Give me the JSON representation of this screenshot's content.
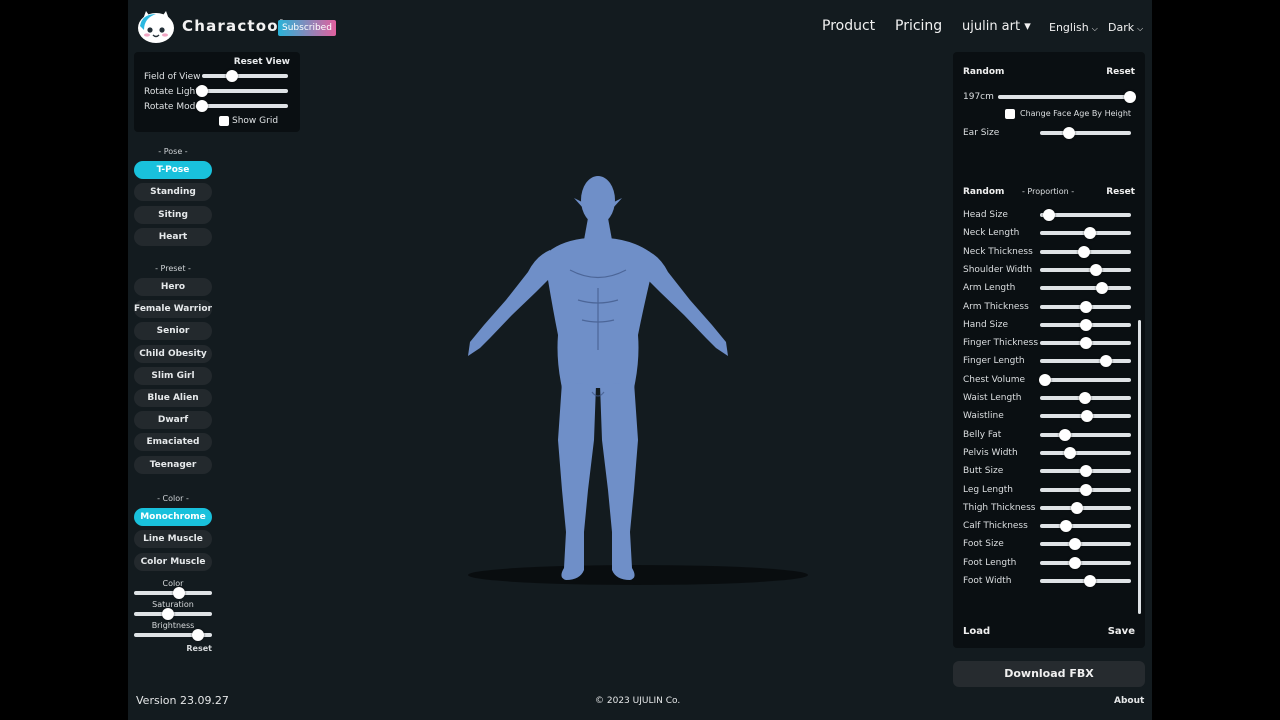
{
  "header": {
    "brand": "Charactool",
    "badge": "Subscribed",
    "nav": {
      "product": "Product",
      "pricing": "Pricing",
      "user": "ujulin art ▾",
      "language": "English",
      "theme": "Dark"
    }
  },
  "view": {
    "reset_label": "Reset View",
    "sliders": [
      {
        "label": "Field of View",
        "value": 0.35
      },
      {
        "label": "Rotate Light",
        "value": 0.0
      },
      {
        "label": "Rotate Model",
        "value": 0.0
      }
    ],
    "show_grid": {
      "label": "Show Grid",
      "checked": false
    }
  },
  "pose": {
    "title": "- Pose -",
    "items": [
      "T-Pose",
      "Standing",
      "Siting",
      "Heart"
    ],
    "active": 0
  },
  "preset": {
    "title": "- Preset -",
    "items": [
      "Hero",
      "Female Warrior",
      "Senior",
      "Child Obesity",
      "Slim Girl",
      "Blue Alien",
      "Dwarf",
      "Emaciated",
      "Teenager"
    ]
  },
  "color": {
    "title": "- Color -",
    "items": [
      "Monochrome",
      "Line Muscle",
      "Color Muscle"
    ],
    "active": 0,
    "sliders": [
      {
        "label": "Color",
        "value": 0.58
      },
      {
        "label": "Saturation",
        "value": 0.44
      },
      {
        "label": "Brightness",
        "value": 0.82
      }
    ],
    "reset_label": "Reset"
  },
  "body": {
    "random_label": "Random",
    "reset_label": "Reset",
    "height": {
      "label": "197cm",
      "value": 0.96
    },
    "face_age": {
      "label": "Change Face Age By Height",
      "checked": false
    },
    "ear_size": {
      "label": "Ear Size",
      "value": 0.32
    }
  },
  "proportion": {
    "random_label": "Random",
    "title": "- Proportion -",
    "reset_label": "Reset",
    "sliders": [
      {
        "label": "Head Size",
        "value": 0.1
      },
      {
        "label": "Neck Length",
        "value": 0.55
      },
      {
        "label": "Neck Thickness",
        "value": 0.48
      },
      {
        "label": "Shoulder Width",
        "value": 0.62
      },
      {
        "label": "Arm Length",
        "value": 0.68
      },
      {
        "label": "Arm Thickness",
        "value": 0.5
      },
      {
        "label": "Hand Size",
        "value": 0.5
      },
      {
        "label": "Finger Thickness",
        "value": 0.5
      },
      {
        "label": "Finger Length",
        "value": 0.72
      },
      {
        "label": "Chest Volume",
        "value": 0.06
      },
      {
        "label": "Waist Length",
        "value": 0.49
      },
      {
        "label": "Waistline",
        "value": 0.52
      },
      {
        "label": "Belly Fat",
        "value": 0.28
      },
      {
        "label": "Pelvis Width",
        "value": 0.33
      },
      {
        "label": "Butt Size",
        "value": 0.51
      },
      {
        "label": "Leg Length",
        "value": 0.51
      },
      {
        "label": "Thigh Thickness",
        "value": 0.41
      },
      {
        "label": "Calf Thickness",
        "value": 0.29
      },
      {
        "label": "Foot Size",
        "value": 0.39
      },
      {
        "label": "Foot Length",
        "value": 0.39
      },
      {
        "label": "Foot Width",
        "value": 0.55
      }
    ],
    "load_label": "Load",
    "save_label": "Save"
  },
  "download_label": "Download FBX",
  "footer": {
    "version": "Version 23.09.27",
    "copyright": "© 2023 UJULIN Co.",
    "about": "About"
  },
  "model_color": "#6f8fc8"
}
